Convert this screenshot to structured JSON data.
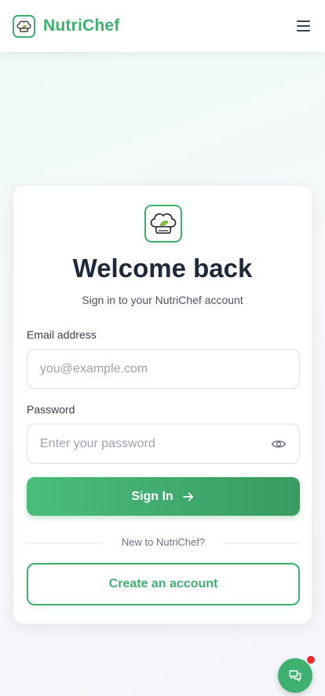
{
  "header": {
    "brand": "NutriChef",
    "menu_icon": "hamburger-menu-icon",
    "logo_icon": "chef-hat-icon"
  },
  "login": {
    "logo_icon": "chef-hat-icon",
    "title": "Welcome back",
    "subtitle": "Sign in to your NutriChef account",
    "email_label": "Email address",
    "email_placeholder": "you@example.com",
    "password_label": "Password",
    "password_placeholder": "Enter your password",
    "password_toggle_icon": "eye-icon",
    "signin_label": "Sign In",
    "signin_icon": "arrow-right-icon",
    "divider_text": "New to NutriChef?",
    "create_label": "Create an account"
  },
  "chat": {
    "icon": "chat-bubbles-icon",
    "has_notification": true
  },
  "colors": {
    "brand": "#3eb170",
    "brand_dark": "#3a9a62",
    "title": "#1e293b",
    "notification": "#ef2b2b"
  }
}
